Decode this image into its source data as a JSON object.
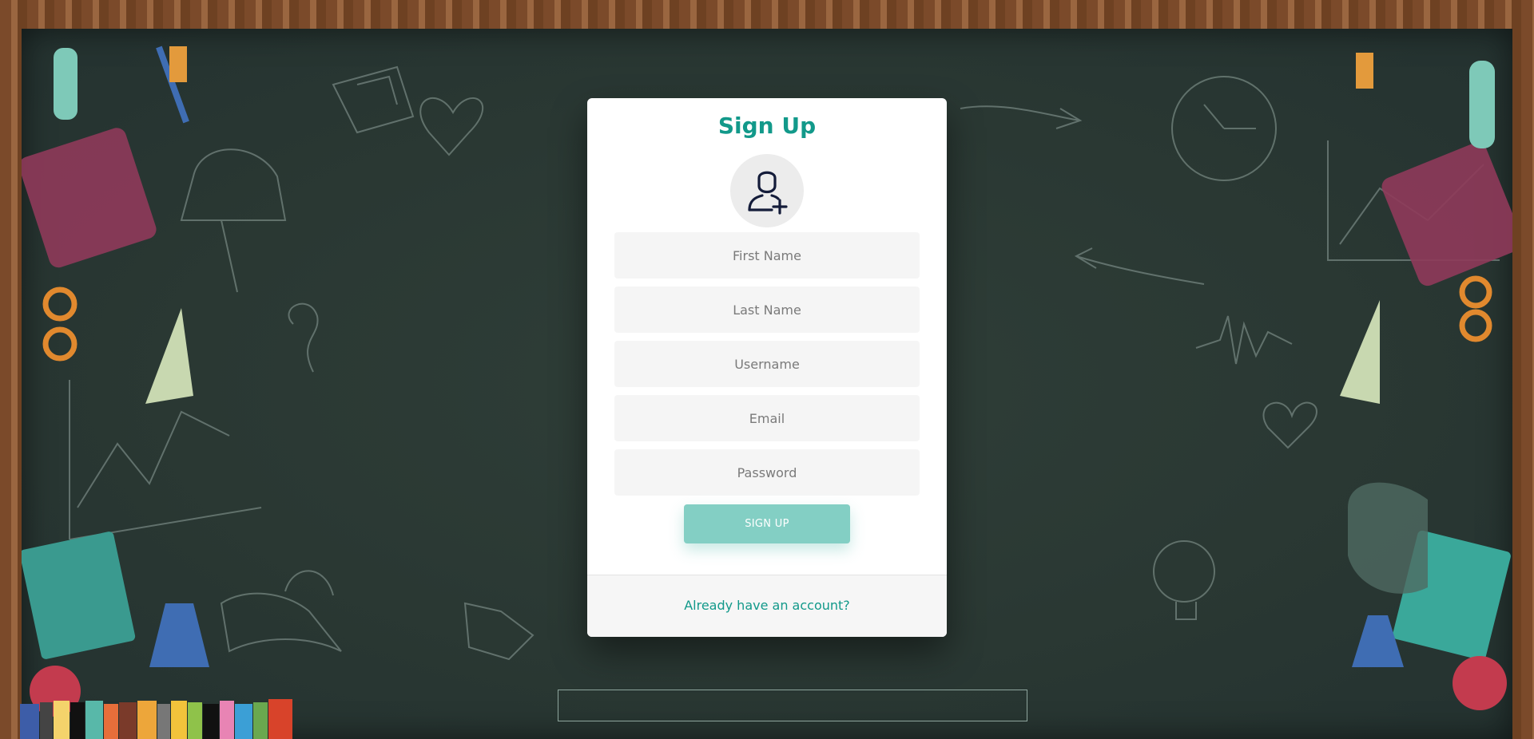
{
  "signup": {
    "title": "Sign Up",
    "avatar_icon": "user-plus-icon",
    "fields": {
      "first_name": {
        "placeholder": "First Name",
        "value": ""
      },
      "last_name": {
        "placeholder": "Last Name",
        "value": ""
      },
      "username": {
        "placeholder": "Username",
        "value": ""
      },
      "email": {
        "placeholder": "Email",
        "value": ""
      },
      "password": {
        "placeholder": "Password",
        "value": ""
      }
    },
    "submit_label": "SIGN UP",
    "footer_link": "Already have an account?"
  },
  "colors": {
    "accent": "#12998a",
    "button": "#83cfc4",
    "board": "#2a3833",
    "frame": "#8a5a35"
  }
}
